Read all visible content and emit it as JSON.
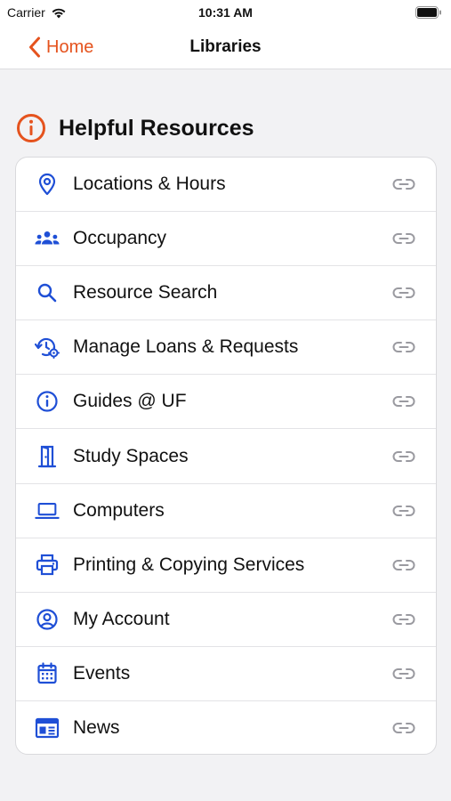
{
  "status": {
    "carrier": "Carrier",
    "time": "10:31 AM"
  },
  "nav": {
    "back_label": "Home",
    "title": "Libraries"
  },
  "section": {
    "title": "Helpful Resources",
    "icon": "info-circle-icon"
  },
  "items": [
    {
      "label": "Locations & Hours",
      "icon": "location-pin-icon"
    },
    {
      "label": "Occupancy",
      "icon": "people-group-icon"
    },
    {
      "label": "Resource Search",
      "icon": "search-icon"
    },
    {
      "label": "Manage Loans & Requests",
      "icon": "history-settings-icon"
    },
    {
      "label": "Guides @ UF",
      "icon": "info-icon"
    },
    {
      "label": "Study Spaces",
      "icon": "door-icon"
    },
    {
      "label": "Computers",
      "icon": "laptop-icon"
    },
    {
      "label": "Printing & Copying Services",
      "icon": "printer-icon"
    },
    {
      "label": "My Account",
      "icon": "account-circle-icon"
    },
    {
      "label": "Events",
      "icon": "calendar-icon"
    },
    {
      "label": "News",
      "icon": "newspaper-icon"
    }
  ],
  "colors": {
    "accent": "#e5531e",
    "icon_blue": "#1f4fd6",
    "link_gray": "#9a9aa0"
  }
}
